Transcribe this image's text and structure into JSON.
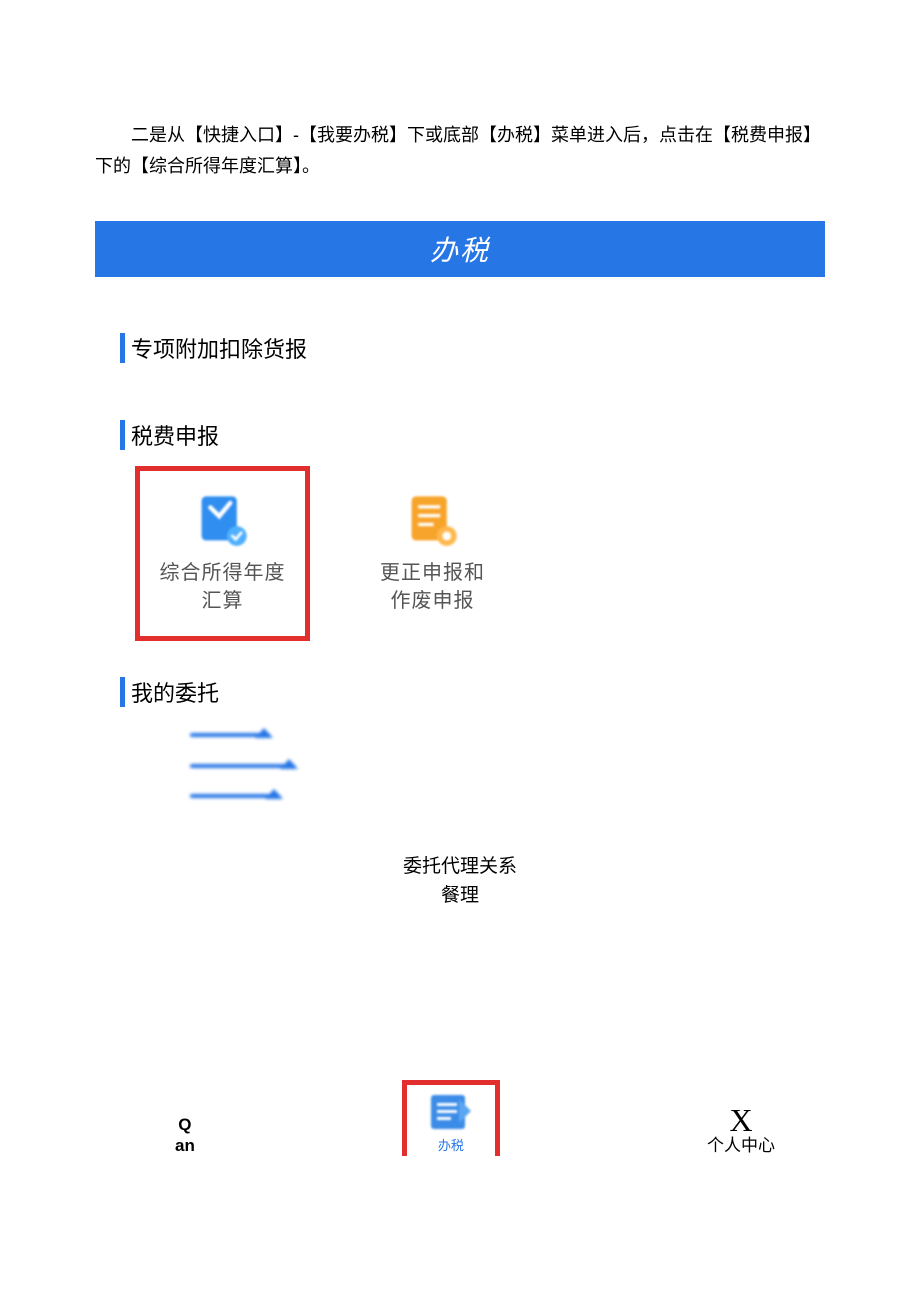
{
  "intro": "二是从【快捷入口】-【我要办税】下或底部【办税】菜单进入后，点击在【税费申报】下的【综合所得年度汇算】。",
  "header": {
    "title": "办税"
  },
  "sections": {
    "sec1": {
      "title": "专项附加扣除货报"
    },
    "sec2": {
      "title": "税费申报",
      "items": [
        {
          "label": "综合所得年度\n汇算",
          "icon": "doc-check-icon",
          "highlighted": true
        },
        {
          "label": "更正申报和\n作废申报",
          "icon": "doc-correct-icon",
          "highlighted": false
        }
      ]
    },
    "sec3": {
      "title": "我的委托"
    }
  },
  "entrust": {
    "label1": "委托代理关系",
    "label2": "餐理"
  },
  "nav": {
    "left": {
      "line1": "Q",
      "line2": "an"
    },
    "center": {
      "label": "办税"
    },
    "right": {
      "icon": "X",
      "label": "个人中心"
    }
  }
}
